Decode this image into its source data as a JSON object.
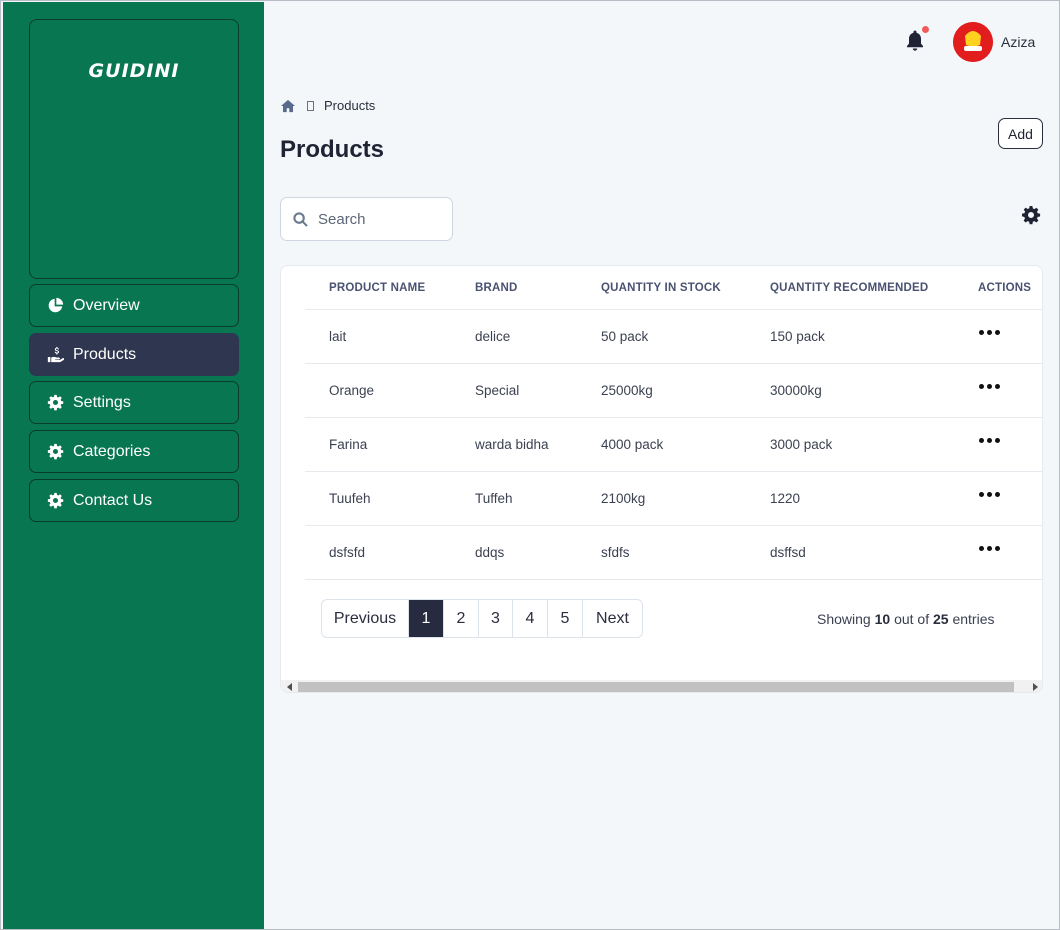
{
  "app": {
    "logo": "GUIDINI"
  },
  "sidebar": {
    "items": [
      {
        "label": "Overview",
        "icon": "pie-chart-icon"
      },
      {
        "label": "Products",
        "icon": "hand-holding-dollar-icon",
        "active": true
      },
      {
        "label": "Settings",
        "icon": "gear-icon"
      },
      {
        "label": "Categories",
        "icon": "gear-icon"
      },
      {
        "label": "Contact Us",
        "icon": "gear-icon"
      }
    ]
  },
  "topbar": {
    "user_name": "Aziza",
    "notification_dot_color": "#f25a5a"
  },
  "breadcrumb": {
    "current": "Products"
  },
  "page": {
    "title": "Products",
    "add_label": "Add"
  },
  "search": {
    "placeholder": "Search",
    "value": ""
  },
  "table": {
    "columns": [
      "PRODUCT NAME",
      "BRAND",
      "QUANTITY IN STOCK",
      "QUANTITY RECOMMENDED",
      "ACTIONS"
    ],
    "rows": [
      [
        "lait",
        "delice",
        "50 pack",
        "150 pack"
      ],
      [
        "Orange",
        "Special",
        "25000kg",
        "30000kg"
      ],
      [
        "Farina",
        "warda bidha",
        "4000 pack",
        "3000 pack"
      ],
      [
        "Tuufeh",
        "Tuffeh",
        "2100kg",
        "1220"
      ],
      [
        "dsfsfd",
        "ddqs",
        "sfdfs",
        "dsffsd"
      ]
    ]
  },
  "pagination": {
    "previous": "Previous",
    "pages": [
      "1",
      "2",
      "3",
      "4",
      "5"
    ],
    "current": "1",
    "next": "Next",
    "showing_prefix": "Showing",
    "shown": "10",
    "out_of": "out of",
    "total": "25",
    "entries": "entries"
  },
  "colors": {
    "sidebar": "#087650",
    "active_nav": "#2e3650",
    "accent": "#262b40"
  }
}
